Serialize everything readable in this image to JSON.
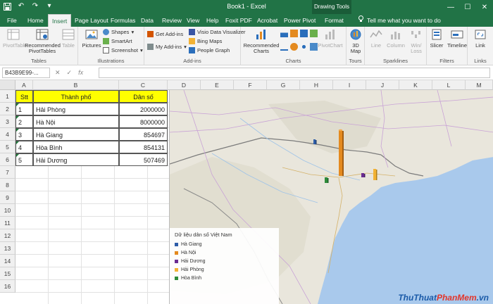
{
  "title": "Book1 - Excel",
  "contextual_tab_group": "Drawing Tools",
  "window_controls": [
    "—",
    "☐",
    "✕"
  ],
  "tabs": [
    "File",
    "Home",
    "Insert",
    "Page Layout",
    "Formulas",
    "Data",
    "Review",
    "View",
    "Help",
    "Foxit PDF",
    "Acrobat",
    "Power Pivot",
    "Format"
  ],
  "active_tab": "Insert",
  "tell_me": "Tell me what you want to do",
  "ribbon": {
    "groups": {
      "tables": "Tables",
      "illustrations": "Illustrations",
      "addins": "Add-ins",
      "charts": "Charts",
      "tours": "Tours",
      "sparklines": "Sparklines",
      "filters": "Filters",
      "links": "Links"
    },
    "pivottable": "PivotTable",
    "recommended_pivot": "Recommended PivotTables",
    "table": "Table",
    "pictures": "Pictures",
    "shapes": "Shapes",
    "smartart": "SmartArt",
    "screenshot": "Screenshot",
    "get_addins": "Get Add-ins",
    "my_addins": "My Add-ins",
    "visio": "Visio Data Visualizer",
    "bing_maps": "Bing Maps",
    "people_graph": "People Graph",
    "recommended_charts": "Recommended Charts",
    "pivotchart": "PivotChart",
    "map_3d": "3D Map",
    "line": "Line",
    "column": "Column",
    "winloss": "Win/ Loss",
    "slicer": "Slicer",
    "timeline": "Timeline",
    "link": "Link"
  },
  "formula_bar": {
    "name_box": "B43B9E99-...",
    "cancel": "✕",
    "enter": "✓",
    "fx": "fx",
    "value": ""
  },
  "columns": [
    "A",
    "B",
    "C",
    "D",
    "E",
    "F",
    "G",
    "H",
    "I",
    "J",
    "K",
    "L",
    "M"
  ],
  "rows": [
    "1",
    "2",
    "3",
    "4",
    "5",
    "6",
    "7",
    "8",
    "9",
    "10",
    "11",
    "12",
    "13",
    "14",
    "15",
    "16"
  ],
  "table": {
    "headers": [
      "Stt",
      "Thành phố",
      "Dân số"
    ],
    "rows": [
      [
        "1",
        "Hải Phòng",
        "2000000"
      ],
      [
        "2",
        "Hà Nội",
        "8000000"
      ],
      [
        "3",
        "Hà Giang",
        "854697"
      ],
      [
        "4",
        "Hòa Bình",
        "854131"
      ],
      [
        "5",
        "Hải Dương",
        "507469"
      ]
    ]
  },
  "map": {
    "legend_title": "Dữ liệu dân số Việt Nam",
    "legend_items": [
      {
        "label": "Hà Giang",
        "color": "#2e5da8"
      },
      {
        "label": "Hà Nội",
        "color": "#e48a1f"
      },
      {
        "label": "Hải Dương",
        "color": "#6a2c91"
      },
      {
        "label": "Hải Phòng",
        "color": "#f2b234"
      },
      {
        "label": "Hòa Bình",
        "color": "#2e8b3a"
      }
    ],
    "bar_values": {
      "Hà Giang": 854697,
      "Hà Nội": 8000000,
      "Hải Dương": 507469,
      "Hải Phòng": 2000000,
      "Hòa Bình": 854131
    }
  },
  "watermark": {
    "part1": "ThuThuat",
    "part2": "PhanMem",
    "part3": ".vn"
  },
  "colors": {
    "excel_green": "#217346",
    "header_yellow": "#ffff00",
    "sea": "#a9c9ec",
    "land": "#e9e6dc"
  }
}
